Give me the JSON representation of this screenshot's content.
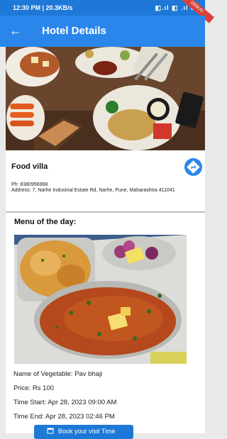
{
  "status_bar": {
    "time": "12:30 PM | 20.3KB/s",
    "icons": "◧.ıl ◧ .ıl 82"
  },
  "debug_banner": "DEBUG",
  "app_bar": {
    "title": "Hotel Details"
  },
  "hotel": {
    "name": "Food villa",
    "phone": "Ph: 8380956868",
    "address": "Address: 7, Narhe Industrial Estate Rd, Narhe, Pune, Maharashtra 411041"
  },
  "menu": {
    "title": "Menu of the day:",
    "vegetable": "Name of Vegetable: Pav bhaji",
    "price": "Price: Rs 100",
    "time_start": "Time Start: Apr 28, 2023 09:00 AM",
    "time_end": "Time End: Apr 28, 2023 02:46 PM",
    "book_label": "Book your visit Time"
  },
  "icons": {
    "back": "arrow-left-icon",
    "directions": "directions-icon",
    "book": "calendar-icon"
  },
  "colors": {
    "primary": "#2a86ea",
    "status": "#1e78d7",
    "debug": "#d9413a"
  }
}
